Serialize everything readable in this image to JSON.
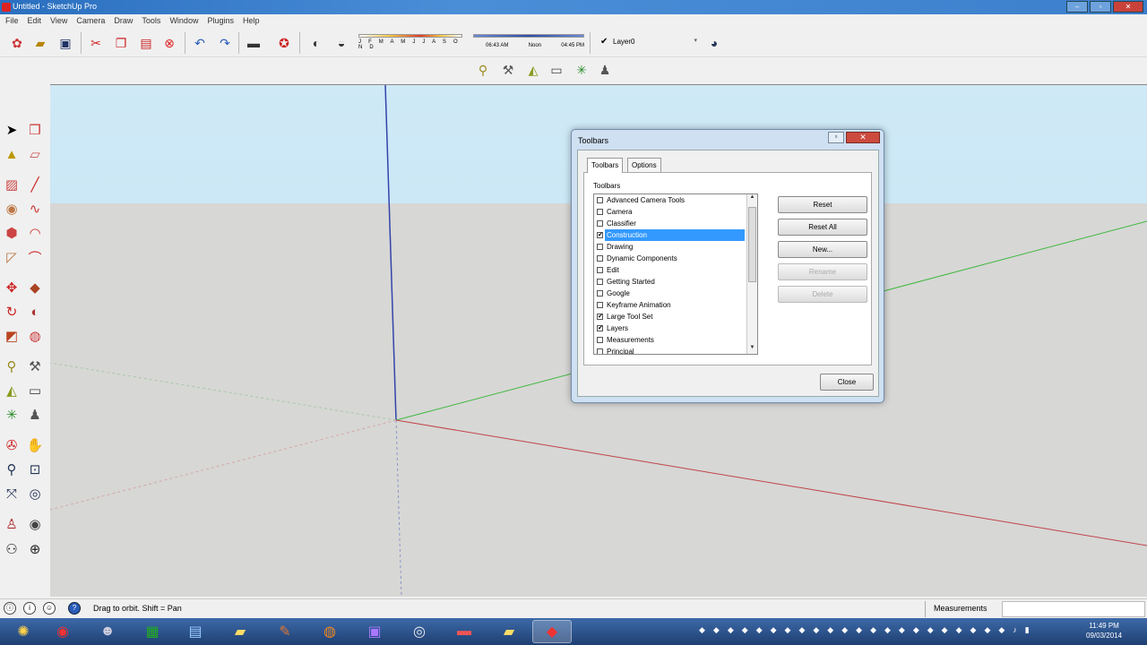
{
  "window": {
    "title": "Untitled - SketchUp Pro",
    "minimize_label": "–",
    "maximize_label": "▫",
    "close_label": "✕"
  },
  "menu": [
    "File",
    "Edit",
    "View",
    "Camera",
    "Draw",
    "Tools",
    "Window",
    "Plugins",
    "Help"
  ],
  "shadows": {
    "months": "J F M A M J J A S O N D",
    "time_start": "06:43 AM",
    "time_mid": "Noon",
    "time_end": "04:45 PM"
  },
  "layer": {
    "current": "Layer0"
  },
  "dialog": {
    "title": "Toolbars",
    "tabs": [
      "Toolbars",
      "Options"
    ],
    "section_label": "Toolbars",
    "items": [
      {
        "label": "Advanced Camera Tools",
        "checked": false
      },
      {
        "label": "Camera",
        "checked": false
      },
      {
        "label": "Classifier",
        "checked": false
      },
      {
        "label": "Construction",
        "checked": true,
        "selected": true
      },
      {
        "label": "Drawing",
        "checked": false
      },
      {
        "label": "Dynamic Components",
        "checked": false
      },
      {
        "label": "Edit",
        "checked": false
      },
      {
        "label": "Getting Started",
        "checked": false
      },
      {
        "label": "Google",
        "checked": false
      },
      {
        "label": "Keyframe Animation",
        "checked": false
      },
      {
        "label": "Large Tool Set",
        "checked": true
      },
      {
        "label": "Layers",
        "checked": true
      },
      {
        "label": "Measurements",
        "checked": false
      },
      {
        "label": "Principal",
        "checked": false
      }
    ],
    "buttons": {
      "reset": "Reset",
      "reset_all": "Reset All",
      "new": "New...",
      "rename": "Rename",
      "delete": "Delete",
      "close": "Close"
    }
  },
  "status": {
    "hint": "Drag to orbit.  Shift = Pan",
    "measurements_label": "Measurements",
    "measurements_value": ""
  },
  "taskbar": {
    "time": "11:49 PM",
    "date": "09/03/2014"
  },
  "colors": {
    "sky": "#cfe9f6",
    "ground": "#d7d7d5",
    "red_axis": "#c0444a",
    "green_axis": "#3fb83f",
    "blue_axis": "#3344aa",
    "selection": "#3399ff"
  }
}
